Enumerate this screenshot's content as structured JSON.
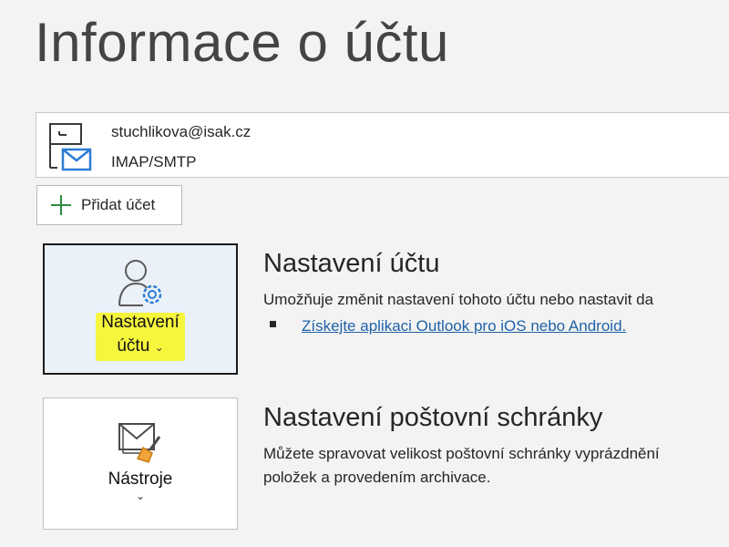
{
  "page": {
    "title": "Informace o účtu"
  },
  "account": {
    "email": "stuchlikova@isak.cz",
    "type": "IMAP/SMTP",
    "icon": "account-mail-icon"
  },
  "add_account": {
    "label": "Přidat účet",
    "icon": "plus-icon"
  },
  "account_settings": {
    "tile_line1": "Nastavení",
    "tile_line2": "účtu",
    "chevron": "⌄",
    "icon": "person-gear-icon",
    "highlight_color": "#f6f63d",
    "title": "Nastavení účtu",
    "description": "Umožňuje změnit nastavení tohoto účtu nebo nastavit da",
    "link": "Získejte aplikaci Outlook pro iOS nebo Android."
  },
  "mailbox_settings": {
    "tile_label": "Nástroje",
    "chevron": "⌄",
    "icon": "mailbox-cleanup-icon",
    "title": "Nastavení poštovní schránky",
    "description_line1": "Můžete spravovat velikost poštovní schránky vyprázdnění",
    "description_line2": "položek a provedením archivace."
  },
  "colors": {
    "accent": "#1f62a8",
    "icon_blue": "#2b7cd3",
    "background": "#f3f3f3"
  }
}
